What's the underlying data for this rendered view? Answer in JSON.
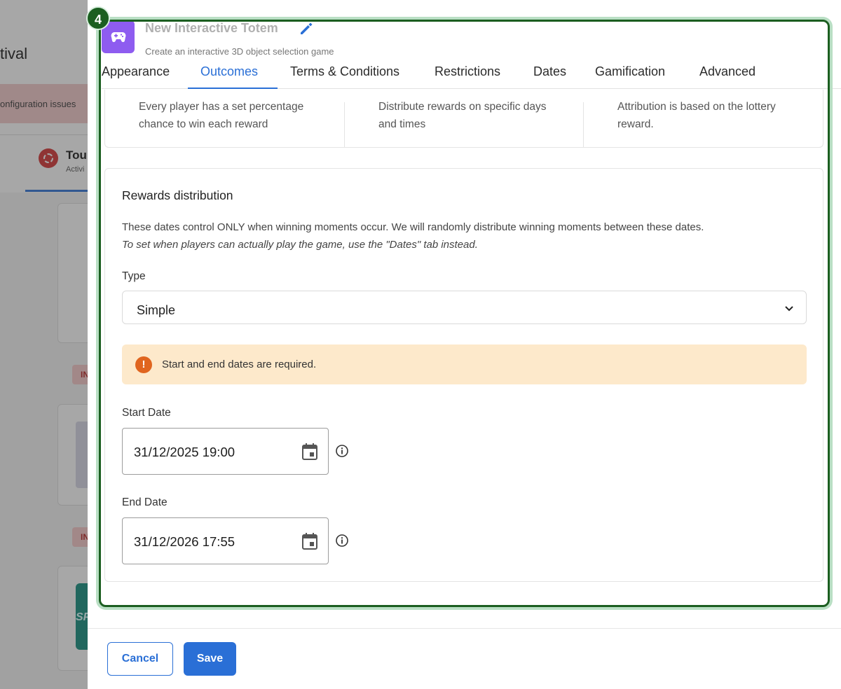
{
  "background": {
    "page_title": "tival",
    "alert_text": "onfiguration issues",
    "tab_title": "Tou",
    "tab_subtitle": "Activi",
    "badge_text": "IN",
    "teal_text": "SP"
  },
  "step": {
    "number": "4"
  },
  "game": {
    "name": "New Interactive Totem",
    "description": "Create an interactive 3D object selection game"
  },
  "tabs": [
    {
      "label": "Appearance"
    },
    {
      "label": "Outcomes"
    },
    {
      "label": "Terms & Conditions"
    },
    {
      "label": "Restrictions"
    },
    {
      "label": "Dates"
    },
    {
      "label": "Gamification"
    },
    {
      "label": "Advanced"
    }
  ],
  "active_tab": "Outcomes",
  "methods": [
    {
      "line1": "Every player has a set percentage",
      "line2": "chance to win each reward"
    },
    {
      "line1": "Distribute rewards on specific days",
      "line2": "and times"
    },
    {
      "line1": "Attribution is based on the lottery",
      "line2": "reward."
    }
  ],
  "distribution": {
    "title": "Rewards distribution",
    "desc_line1": "These dates control ONLY when winning moments occur. We will randomly distribute winning moments between these dates.",
    "desc_line2": "To set when players can actually play the game, use the \"Dates\" tab instead.",
    "type_label": "Type",
    "type_value": "Simple",
    "warning": "Start and end dates are required.",
    "start_label": "Start Date",
    "start_value": "31/12/2025 19:00",
    "end_label": "End Date",
    "end_value": "31/12/2026 17:55"
  },
  "footer": {
    "cancel_label": "Cancel",
    "save_label": "Save"
  },
  "colors": {
    "accent": "#2a6fd6",
    "focus_ring": "#1b5e20",
    "warning_bg": "#fde9cb",
    "warning_icon": "#e0651f",
    "game_icon": "#8e5cf0"
  }
}
